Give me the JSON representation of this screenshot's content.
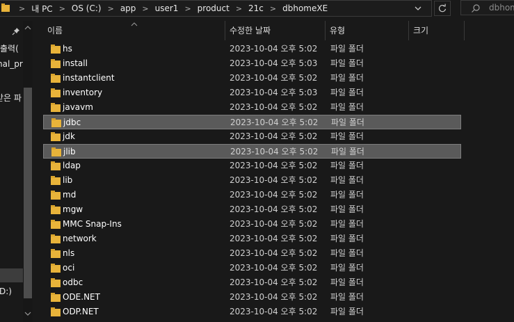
{
  "address": {
    "crumbs": [
      "내 PC",
      "OS (C:)",
      "app",
      "user1",
      "product",
      "21c",
      "dbhomeXE"
    ]
  },
  "search": {
    "placeholder": "dbhom"
  },
  "nav": {
    "lines": [
      "출력(",
      "nal_pra",
      "받은 파",
      "D:)"
    ]
  },
  "columns": {
    "name": "이름",
    "date": "수정한 날짜",
    "type": "유형",
    "size": "크기"
  },
  "colors": {
    "folder": "#e8b33a",
    "selected_row": "#5a5a5a"
  },
  "rows": [
    {
      "name": "hs",
      "date": "2023-10-04 오후 5:02",
      "type": "파일 폴더",
      "selected": false
    },
    {
      "name": "install",
      "date": "2023-10-04 오후 5:03",
      "type": "파일 폴더",
      "selected": false
    },
    {
      "name": "instantclient",
      "date": "2023-10-04 오후 5:02",
      "type": "파일 폴더",
      "selected": false
    },
    {
      "name": "inventory",
      "date": "2023-10-04 오후 5:03",
      "type": "파일 폴더",
      "selected": false
    },
    {
      "name": "javavm",
      "date": "2023-10-04 오후 5:02",
      "type": "파일 폴더",
      "selected": false
    },
    {
      "name": "jdbc",
      "date": "2023-10-04 오후 5:02",
      "type": "파일 폴더",
      "selected": true
    },
    {
      "name": "jdk",
      "date": "2023-10-04 오후 5:02",
      "type": "파일 폴더",
      "selected": false
    },
    {
      "name": "jlib",
      "date": "2023-10-04 오후 5:02",
      "type": "파일 폴더",
      "selected": true
    },
    {
      "name": "ldap",
      "date": "2023-10-04 오후 5:02",
      "type": "파일 폴더",
      "selected": false
    },
    {
      "name": "lib",
      "date": "2023-10-04 오후 5:02",
      "type": "파일 폴더",
      "selected": false
    },
    {
      "name": "md",
      "date": "2023-10-04 오후 5:02",
      "type": "파일 폴더",
      "selected": false
    },
    {
      "name": "mgw",
      "date": "2023-10-04 오후 5:02",
      "type": "파일 폴더",
      "selected": false
    },
    {
      "name": "MMC Snap-Ins",
      "date": "2023-10-04 오후 5:02",
      "type": "파일 폴더",
      "selected": false
    },
    {
      "name": "network",
      "date": "2023-10-04 오후 5:02",
      "type": "파일 폴더",
      "selected": false
    },
    {
      "name": "nls",
      "date": "2023-10-04 오후 5:02",
      "type": "파일 폴더",
      "selected": false
    },
    {
      "name": "oci",
      "date": "2023-10-04 오후 5:02",
      "type": "파일 폴더",
      "selected": false
    },
    {
      "name": "odbc",
      "date": "2023-10-04 오후 5:02",
      "type": "파일 폴더",
      "selected": false
    },
    {
      "name": "ODE.NET",
      "date": "2023-10-04 오후 5:02",
      "type": "파일 폴더",
      "selected": false
    },
    {
      "name": "ODP.NET",
      "date": "2023-10-04 오후 5:02",
      "type": "파일 폴더",
      "selected": false
    }
  ]
}
